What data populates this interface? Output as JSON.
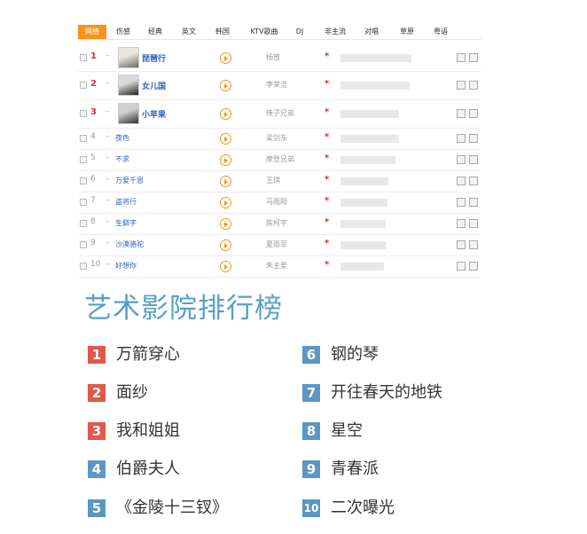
{
  "tabs": [
    "网络",
    "伤感",
    "经典",
    "英文",
    "韩国",
    "KTV歌曲",
    "DJ",
    "非主流",
    "对唱",
    "草原",
    "粤语"
  ],
  "active_tab": "网络",
  "songs": [
    {
      "rank": "1",
      "title": "琵琶行",
      "artist": "杨放",
      "bar": 0.8,
      "top": true
    },
    {
      "rank": "2",
      "title": "女儿国",
      "artist": "李荣浩",
      "bar": 0.78,
      "top": true
    },
    {
      "rank": "3",
      "title": "小苹果",
      "artist": "筷子兄弟",
      "bar": 0.66,
      "top": true
    },
    {
      "rank": "4",
      "title": "夜色",
      "artist": "梁剑东",
      "bar": 0.66,
      "top": false
    },
    {
      "rank": "5",
      "title": "不求",
      "artist": "摩登兄弟",
      "bar": 0.62,
      "top": false
    },
    {
      "rank": "6",
      "title": "万爱千恩",
      "artist": "王琪",
      "bar": 0.54,
      "top": false
    },
    {
      "rank": "7",
      "title": "盗将行",
      "artist": "马雨阳",
      "bar": 0.53,
      "top": false
    },
    {
      "rank": "8",
      "title": "生僻字",
      "artist": "陈柯宇",
      "bar": 0.51,
      "top": false
    },
    {
      "rank": "9",
      "title": "沙漠骆驼",
      "artist": "夏雨菲",
      "bar": 0.51,
      "top": false
    },
    {
      "rank": "10",
      "title": "好想你",
      "artist": "朱主爱",
      "bar": 0.49,
      "top": false
    }
  ],
  "heading": "艺术影院排行榜",
  "ranking": [
    {
      "num": "1",
      "text": "万箭穿心",
      "color": "#e2574c"
    },
    {
      "num": "2",
      "text": "面纱",
      "color": "#e2574c"
    },
    {
      "num": "3",
      "text": "我和姐姐",
      "color": "#e2574c"
    },
    {
      "num": "4",
      "text": "伯爵夫人",
      "color": "#5b97c2"
    },
    {
      "num": "5",
      "text": "《金陵十三钗》",
      "color": "#5b97c2"
    },
    {
      "num": "6",
      "text": "钢的琴",
      "color": "#5b97c2"
    },
    {
      "num": "7",
      "text": "开往春天的地铁",
      "color": "#5b97c2"
    },
    {
      "num": "8",
      "text": "星空",
      "color": "#5b97c2"
    },
    {
      "num": "9",
      "text": "青春派",
      "color": "#5b97c2"
    },
    {
      "num": "10",
      "text": "二次曝光",
      "color": "#5b97c2"
    }
  ]
}
